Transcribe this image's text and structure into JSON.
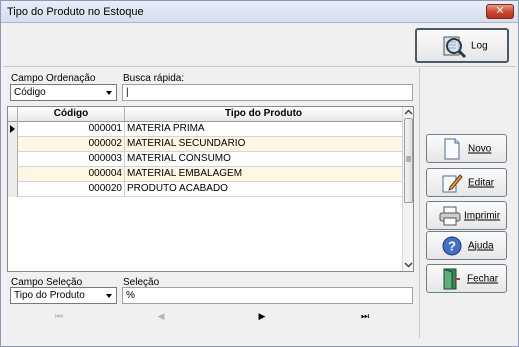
{
  "window": {
    "title": "Tipo do Produto no Estoque",
    "close_glyph": "✕"
  },
  "toolbar": {
    "log_label": "Log"
  },
  "sort": {
    "label": "Campo Ordenação",
    "value": "Código"
  },
  "quick_search": {
    "label": "Busca rápida:",
    "value": "|"
  },
  "grid": {
    "columns": [
      "Código",
      "Tipo do Produto"
    ],
    "rows": [
      {
        "codigo": "000001",
        "tipo": "MATERIA PRIMA",
        "selected": true
      },
      {
        "codigo": "000002",
        "tipo": "MATERIAL SECUNDARIO"
      },
      {
        "codigo": "000003",
        "tipo": "MATERIAL CONSUMO"
      },
      {
        "codigo": "000004",
        "tipo": "MATERIAL EMBALAGEM"
      },
      {
        "codigo": "000020",
        "tipo": "PRODUTO ACABADO"
      }
    ]
  },
  "selection_field": {
    "label": "Campo Seleção",
    "value": "Tipo do Produto"
  },
  "selection": {
    "label": "Seleção",
    "value": "%"
  },
  "actions": {
    "novo": "Novo",
    "editar": "Editar",
    "imprimir": "Imprimir",
    "ajuda": "Ajuda",
    "fechar": "Fechar"
  },
  "nav": {
    "first": "⏮",
    "prev": "◀",
    "next": "▶",
    "last": "⏭"
  },
  "colors": {
    "alt_row": "#fdf7e4",
    "close": "#c9442a"
  }
}
